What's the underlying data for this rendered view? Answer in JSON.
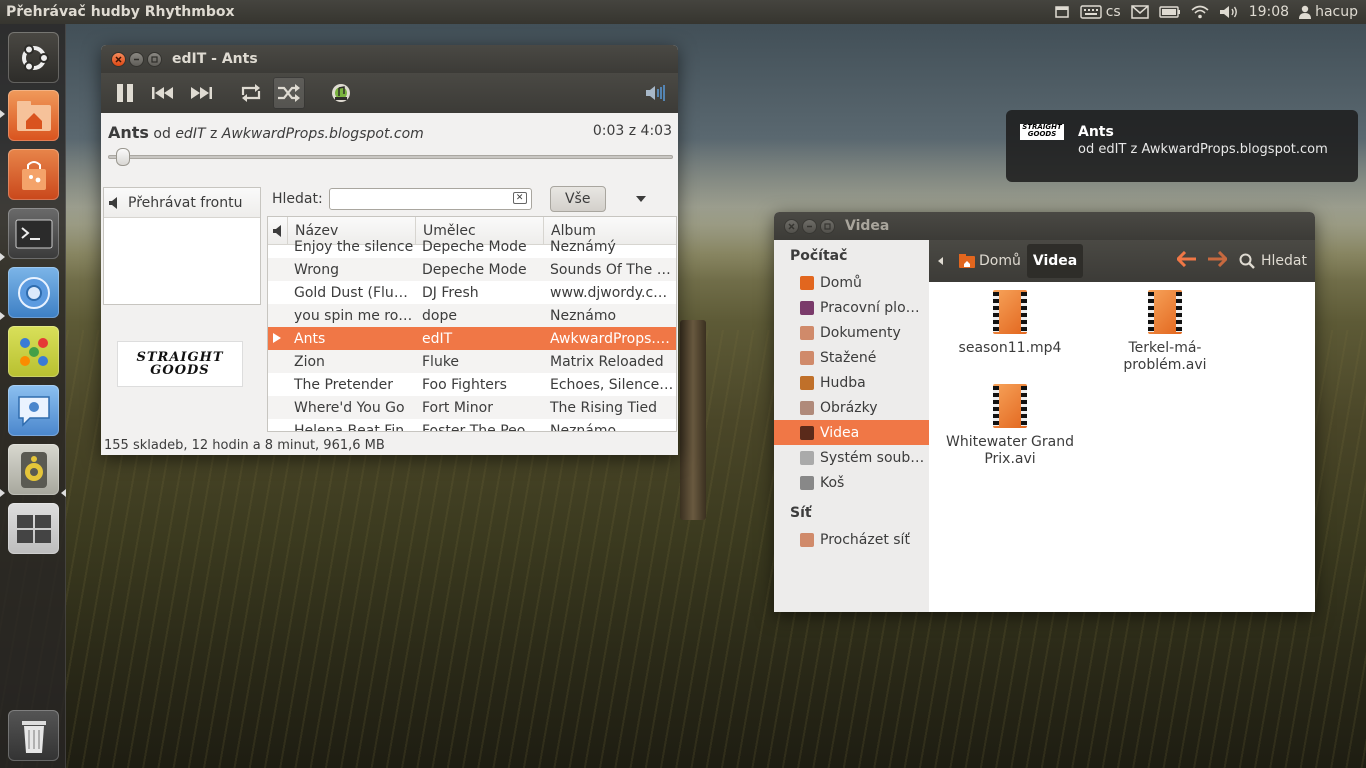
{
  "top_panel": {
    "app_title": "Přehrávač hudby Rhythmbox",
    "keyboard_layout": "cs",
    "clock": "19:08",
    "user": "hacup"
  },
  "launcher": {
    "items": [
      {
        "name": "dash-home",
        "icon": "ubuntu-logo-icon"
      },
      {
        "name": "home-folder",
        "icon": "folder-home-icon"
      },
      {
        "name": "software-center",
        "icon": "shopping-bag-icon"
      },
      {
        "name": "terminal",
        "icon": "terminal-icon"
      },
      {
        "name": "chromium",
        "icon": "chromium-icon"
      },
      {
        "name": "board-game",
        "icon": "game-icon"
      },
      {
        "name": "empathy",
        "icon": "chat-icon"
      },
      {
        "name": "rhythmbox",
        "icon": "speaker-icon"
      },
      {
        "name": "workspaces",
        "icon": "workspace-switcher-icon"
      },
      {
        "name": "trash",
        "icon": "trash-icon"
      }
    ]
  },
  "rhythmbox": {
    "title": "edIT - Ants",
    "now_playing": {
      "song": "Ants",
      "by_word": "od",
      "artist": "edIT",
      "from_word": "z",
      "album": "AwkwardProps.blogspot.com",
      "time": "0:03 z 4:03",
      "progress": 0.012
    },
    "queue_label": "Přehrávat frontu",
    "album_art_text": "STRAIGHT GOODS",
    "search_label": "Hledat:",
    "search_value": "",
    "filter_button": "Vše",
    "columns": [
      "Název",
      "Umělec",
      "Album"
    ],
    "rows": [
      {
        "title": "Enjoy the silence",
        "artist": "Depeche Mode",
        "album": "Neznámý"
      },
      {
        "title": "Wrong",
        "artist": "Depeche Mode",
        "album": "Sounds Of The …"
      },
      {
        "title": "Gold Dust (Flux …",
        "artist": "DJ Fresh",
        "album": "www.djwordy.c…"
      },
      {
        "title": "you spin me rou…",
        "artist": "dope",
        "album": "Neznámo"
      },
      {
        "title": "Ants",
        "artist": "edIT",
        "album": "AwkwardProps.…",
        "playing": true
      },
      {
        "title": "Zion",
        "artist": "Fluke",
        "album": "Matrix Reloaded"
      },
      {
        "title": "The Pretender",
        "artist": "Foo Fighters",
        "album": "Echoes, Silence,…"
      },
      {
        "title": "Where'd You Go",
        "artist": "Fort Minor",
        "album": "The Rising Tied"
      },
      {
        "title": "Helena Beat Fin",
        "artist": "Foster The Peo",
        "album": "Neznámo"
      }
    ],
    "status": "155 skladeb, 12 hodin a 8 minut, 961,6 MB"
  },
  "notification": {
    "title": "Ants",
    "body": "od edIT z AwkwardProps.blogspot.com",
    "image_text": "STRAIGHT GOODS"
  },
  "nautilus": {
    "title": "Videa",
    "sidebar": {
      "computer_header": "Počítač",
      "items": [
        {
          "label": "Domů",
          "icon": "home-folder-icon"
        },
        {
          "label": "Pracovní plo…",
          "icon": "desktop-icon"
        },
        {
          "label": "Dokumenty",
          "icon": "documents-folder-icon"
        },
        {
          "label": "Stažené",
          "icon": "downloads-folder-icon"
        },
        {
          "label": "Hudba",
          "icon": "music-folder-icon"
        },
        {
          "label": "Obrázky",
          "icon": "pictures-folder-icon"
        },
        {
          "label": "Videa",
          "icon": "videos-folder-icon",
          "selected": true
        },
        {
          "label": "Systém soub…",
          "icon": "filesystem-icon"
        },
        {
          "label": "Koš",
          "icon": "trash-icon"
        }
      ],
      "network_header": "Síť",
      "network_items": [
        {
          "label": "Procházet síť",
          "icon": "network-folder-icon"
        }
      ]
    },
    "path": [
      "Domů",
      "Videa"
    ],
    "search_label": "Hledat",
    "files": [
      {
        "name": "season11.mp4"
      },
      {
        "name": "Terkel-má-problém.avi"
      },
      {
        "name": "Whitewater Grand Prix.avi"
      }
    ]
  },
  "colors": {
    "accent": "#f07746",
    "panel": "#3c3b37",
    "close_button": "#dd4814"
  }
}
